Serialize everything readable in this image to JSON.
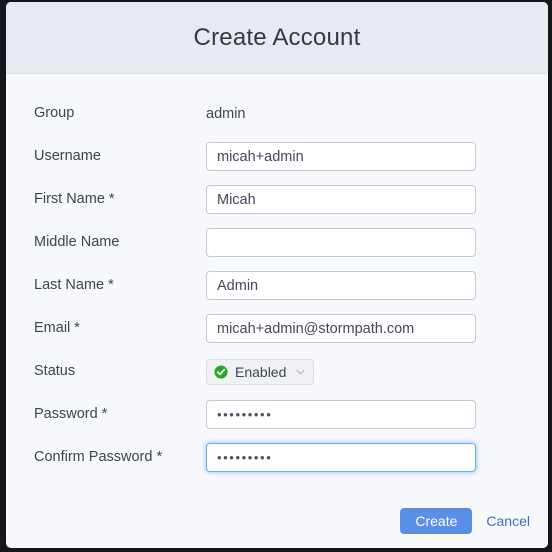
{
  "modal": {
    "title": "Create Account",
    "fields": [
      {
        "label": "Group",
        "type": "static",
        "value": "admin",
        "name": "group"
      },
      {
        "label": "Username",
        "type": "text",
        "value": "micah+admin",
        "placeholder": "",
        "name": "username"
      },
      {
        "label": "First Name *",
        "type": "text",
        "value": "Micah",
        "placeholder": "",
        "name": "first-name"
      },
      {
        "label": "Middle Name",
        "type": "text",
        "value": "",
        "placeholder": "",
        "name": "middle-name"
      },
      {
        "label": "Last Name *",
        "type": "text",
        "value": "Admin",
        "placeholder": "",
        "name": "last-name"
      },
      {
        "label": "Email *",
        "type": "text",
        "value": "micah+admin@stormpath.com",
        "placeholder": "",
        "name": "email"
      },
      {
        "label": "Status",
        "type": "select",
        "value": "Enabled",
        "icon": "check-circle-icon",
        "caret": "chevron-down-icon",
        "name": "status"
      },
      {
        "label": "Password *",
        "type": "password",
        "value": "•••••••••",
        "focused": false,
        "name": "password"
      },
      {
        "label": "Confirm Password *",
        "type": "password",
        "value": "•••••••••",
        "focused": true,
        "name": "confirm-password"
      }
    ],
    "footer": {
      "create_label": "Create",
      "cancel_label": "Cancel"
    }
  },
  "colors": {
    "header_bg": "#e8eaf2",
    "body_bg": "#f7f8fc",
    "primary_button": "#5b8fe6",
    "link": "#3f6fd0",
    "status_enabled": "#2aa72a",
    "focus_border": "#66afe9"
  }
}
